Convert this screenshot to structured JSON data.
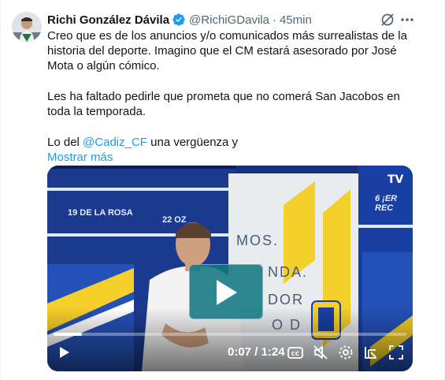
{
  "tweet": {
    "author_name": "Richi González Dávila",
    "handle": "@RichiGDavila",
    "separator": "·",
    "time": "45min",
    "text_p1": "Creo que es de los anuncios y/o comunicados más surrealistas de la historia del deporte. Imagino que el CM estará asesorado por José Mota o algún cómico.",
    "text_p2": "Les ha faltado pedirle que prometa que no comerá San Jacobos en toda la temporada.",
    "text_p3_prefix": "Lo del ",
    "mention": "@Cadiz_CF",
    "text_p3_suffix": " una vergüenza y",
    "show_more": "Mostrar más"
  },
  "video": {
    "timecode": "0:07 / 1:24",
    "progress": 0.08,
    "watermark": "TV",
    "scene_text": {
      "banner_left_1": "19 DE LA ROSA",
      "banner_left_2": "22 OZ",
      "banner_right": "6 ¡ER REC",
      "wall_lines": [
        "MOS.",
        "NDA.",
        "DOR",
        "O D"
      ]
    }
  },
  "icons": {
    "verified": "verified-badge-icon",
    "grok": "grok-icon",
    "more": "more-dots-icon",
    "play": "play-icon",
    "captions": "captions-icon",
    "mute": "mute-icon",
    "settings": "gear-icon",
    "pip": "picture-in-picture-icon",
    "fullscreen": "fullscreen-icon"
  },
  "colors": {
    "link": "#1d9bf0",
    "verified": "#1d9bf0",
    "secondary_text": "#536471"
  }
}
